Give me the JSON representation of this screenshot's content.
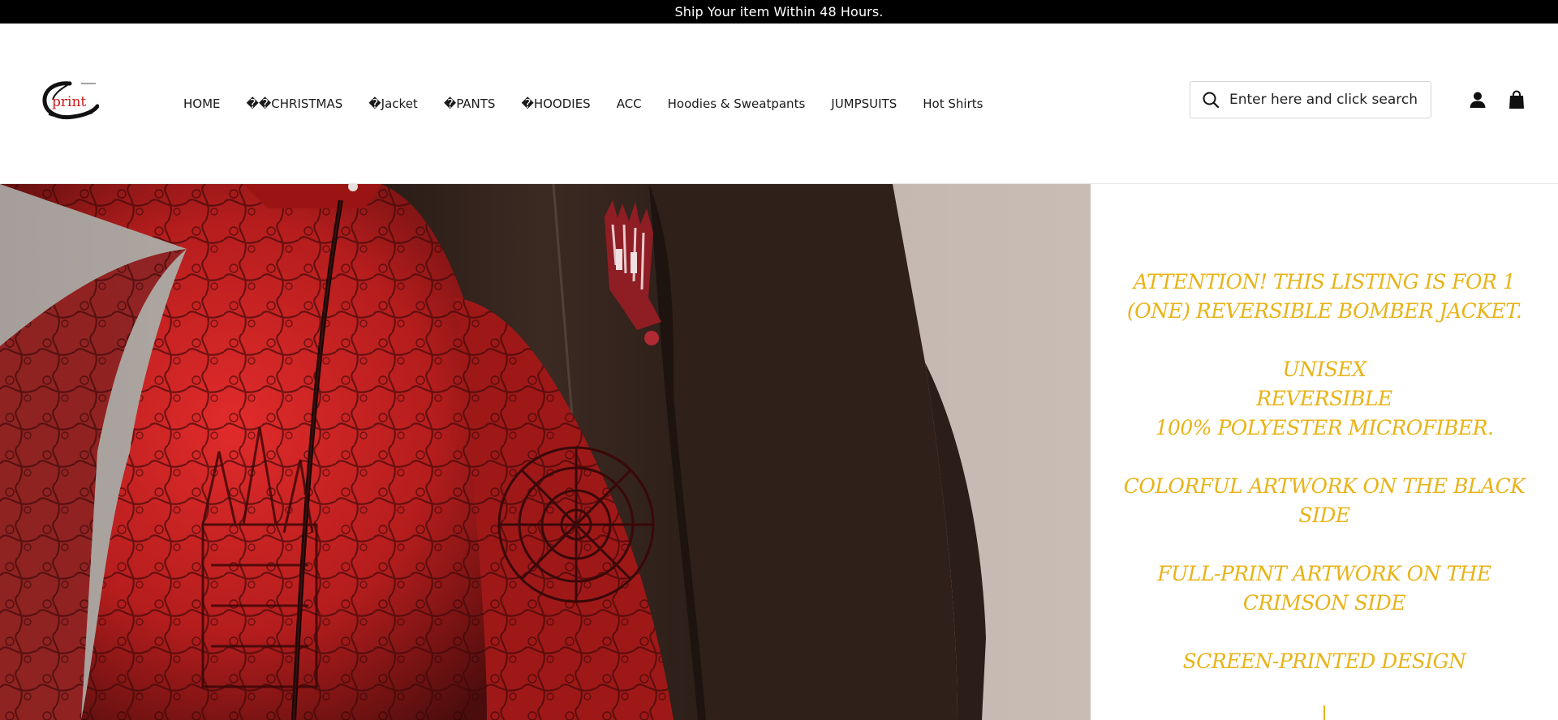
{
  "announcement": {
    "text": "Ship Your item Within 48 Hours."
  },
  "logo": {
    "text": "print",
    "icon": "brush-circle-logo"
  },
  "nav": {
    "items": [
      {
        "label": "HOME"
      },
      {
        "label": "��CHRISTMAS"
      },
      {
        "label": "�Jacket"
      },
      {
        "label": "�PANTS"
      },
      {
        "label": "�HOODIES"
      },
      {
        "label": "ACC"
      },
      {
        "label": "Hoodies & Sweatpants"
      },
      {
        "label": "JUMPSUITS"
      },
      {
        "label": "Hot Shirts"
      }
    ]
  },
  "search": {
    "placeholder": "Enter here and click search",
    "icon": "search-icon"
  },
  "header_icons": {
    "account": "user-icon",
    "cart": "shopping-bag-icon"
  },
  "product": {
    "description": [
      "ATTENTION! THIS LISTING IS FOR 1 (ONE) REVERSIBLE BOMBER JACKET.",
      "UNISEX\nREVERSIBLE\n100% POLYESTER MICROFIBER.",
      "COLORFUL ARTWORK ON THE BLACK SIDE",
      "FULL-PRINT ARTWORK ON THE CRIMSON SIDE",
      "SCREEN-PRINTED DESIGN"
    ],
    "accent_color": "#e8b317"
  }
}
